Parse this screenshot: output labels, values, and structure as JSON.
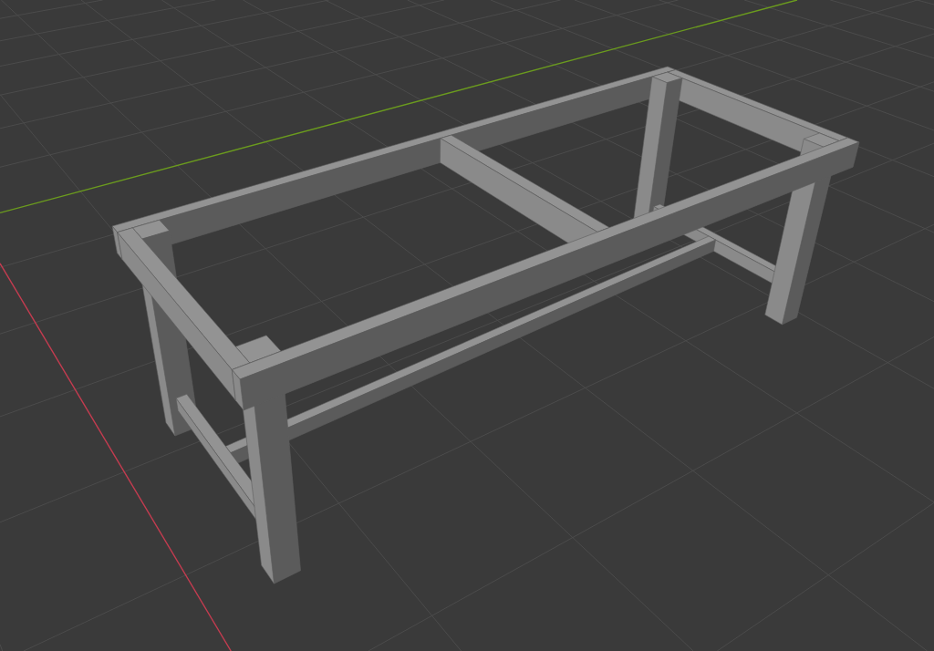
{
  "viewport": {
    "axes": [
      {
        "kind": "x",
        "color": "#c43c50"
      },
      {
        "kind": "y",
        "color": "#6b9b1e"
      }
    ]
  }
}
